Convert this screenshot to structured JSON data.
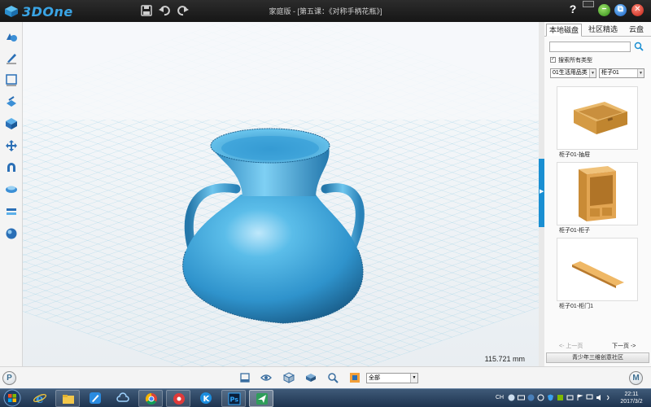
{
  "app": {
    "logo_text": "3DOne",
    "document_title": "家庭版 - [第五课：《对称手柄花瓶》]",
    "help_label": "?"
  },
  "viewport": {
    "measurement": "115.721 mm"
  },
  "right_panel": {
    "tabs": [
      {
        "label": "本地磁盘",
        "active": true
      },
      {
        "label": "社区精选",
        "active": false
      },
      {
        "label": "云盘",
        "active": false
      }
    ],
    "search_value": "",
    "search_all_types_label": "搜索所有类型",
    "search_all_types_checked": true,
    "category_select": "01生活用品类",
    "subcategory_select": "柜子01",
    "items": [
      {
        "label": "柜子01-抽屉"
      },
      {
        "label": "柜子01-柜子"
      },
      {
        "label": "柜子01-柜门1"
      }
    ],
    "prev_page": "<- 上一页",
    "next_page": "下一页 ->",
    "community_button": "青少年三维创意社区"
  },
  "bottom_toolbar": {
    "view_select": "全部",
    "left_badge": "P",
    "right_badge": "M"
  },
  "taskbar": {
    "lang": "CH",
    "time": "22:11",
    "date": "2017/3/2"
  },
  "colors": {
    "model_blue": "#3aa6dc",
    "accent_blue": "#1a8fd2",
    "grid_line": "#7fc7e3"
  }
}
